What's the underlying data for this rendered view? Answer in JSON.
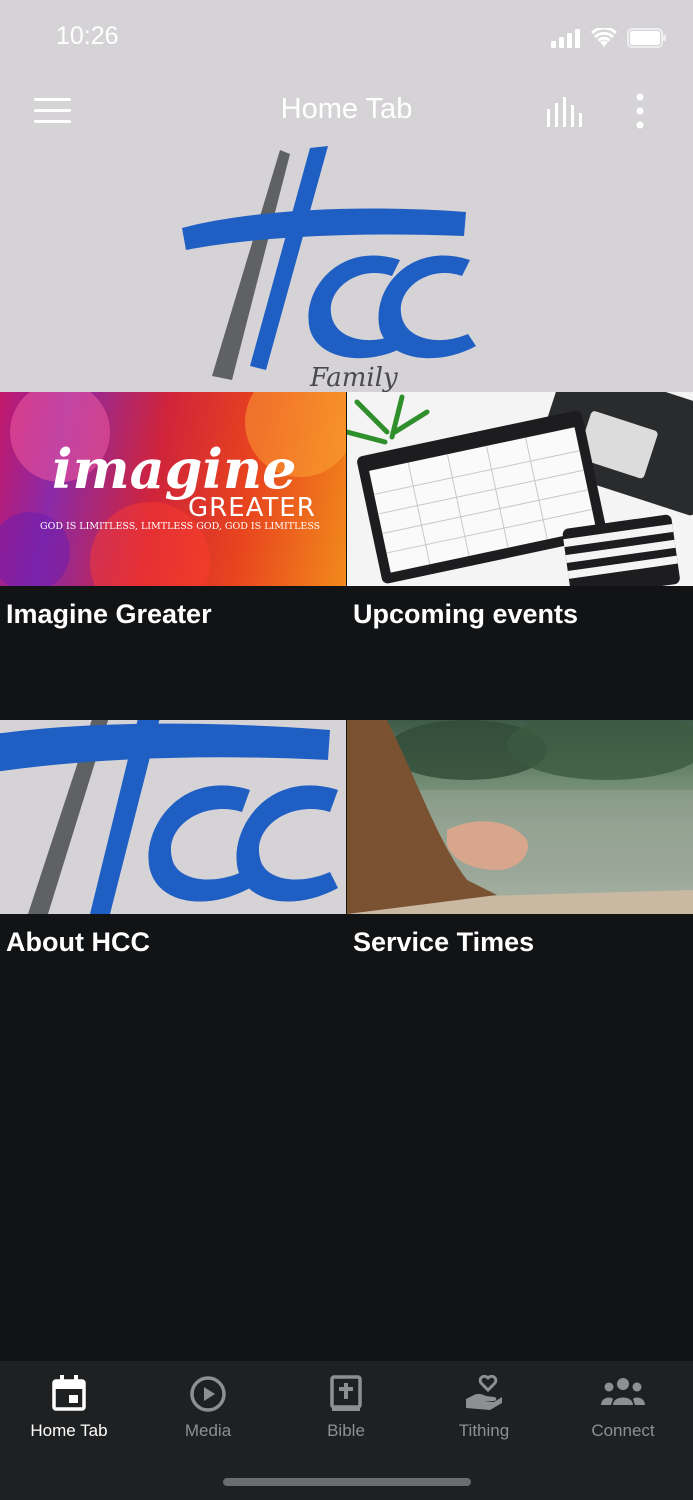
{
  "status_bar": {
    "time": "10:26"
  },
  "nav": {
    "title": "Home Tab"
  },
  "banner": {
    "logo_text": "HCC",
    "logo_subtext": "Family"
  },
  "tiles": [
    {
      "label": "Imagine Greater",
      "thumb_title": "imagine",
      "thumb_sub": "GREATER",
      "thumb_tagline": "GOD IS LIMITLESS, LIMTLESS GOD, GOD IS LIMITLESS"
    },
    {
      "label": "Upcoming events"
    },
    {
      "label": "About HCC",
      "thumb_text": "HCC"
    },
    {
      "label": "Service Times"
    }
  ],
  "tabbar": {
    "items": [
      {
        "label": "Home Tab",
        "icon": "calendar-icon",
        "active": true
      },
      {
        "label": "Media",
        "icon": "play-circle-icon",
        "active": false
      },
      {
        "label": "Bible",
        "icon": "bible-icon",
        "active": false
      },
      {
        "label": "Tithing",
        "icon": "giving-hand-icon",
        "active": false
      },
      {
        "label": "Connect",
        "icon": "group-icon",
        "active": false
      }
    ]
  },
  "colors": {
    "header_bg": "#d5d3d6",
    "body_bg": "#121315",
    "tabbar_bg": "#1f2022",
    "logo_blue": "#1f5fc4",
    "logo_gray": "#5f6163"
  }
}
